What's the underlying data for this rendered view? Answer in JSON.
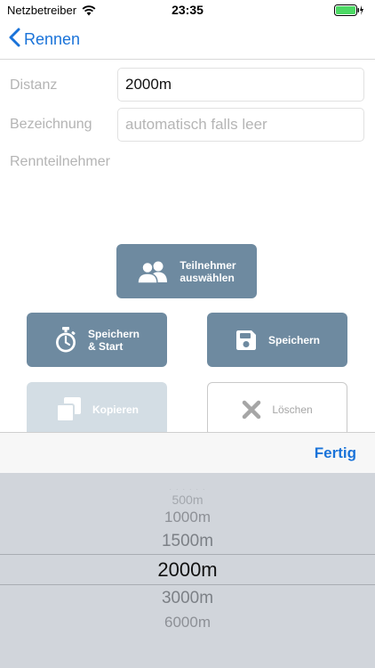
{
  "status_bar": {
    "carrier": "Netzbetreiber",
    "time": "23:35"
  },
  "nav": {
    "back_label": "Rennen"
  },
  "form": {
    "distance_label": "Distanz",
    "distance_value": "2000m",
    "name_label": "Bezeichnung",
    "name_value": "",
    "name_placeholder": "automatisch falls leer",
    "participants_label": "Rennteilnehmer"
  },
  "buttons": {
    "select_participants": [
      "Teilnehmer",
      "auswählen"
    ],
    "save_and_start": [
      "Speichern",
      "& Start"
    ],
    "save": "Speichern",
    "copy": "Kopieren",
    "delete": "Löschen"
  },
  "picker": {
    "done_label": "Fertig",
    "options": [
      "500m",
      "1000m",
      "1500m",
      "2000m",
      "3000m",
      "6000m"
    ],
    "selected": "2000m"
  },
  "colors": {
    "accent": "#1a73d9",
    "button_primary": "#6e8aa0",
    "button_disabled": "#d3dde4",
    "battery": "#4cd964"
  }
}
